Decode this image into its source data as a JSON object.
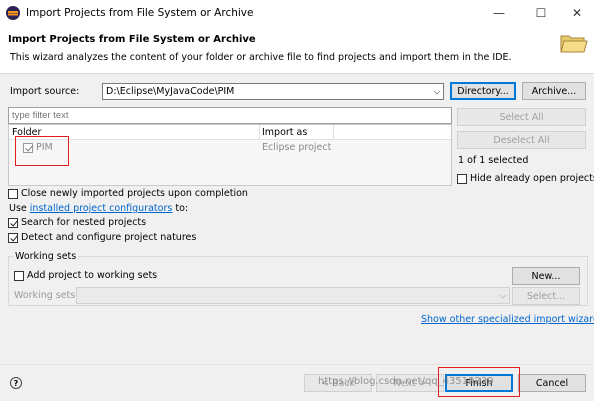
{
  "window": {
    "title": "Import Projects from File System or Archive",
    "minimize": "—",
    "maximize": "☐",
    "close": "✕"
  },
  "header": {
    "title": "Import Projects from File System or Archive",
    "description": "This wizard analyzes the content of your folder or archive file to find projects and import them in the IDE."
  },
  "source": {
    "label": "Import source:",
    "value": "D:\\Eclipse\\MyJavaCode\\PIM",
    "directory_button": "Directory...",
    "archive_button": "Archive..."
  },
  "filter": {
    "placeholder": "type filter text"
  },
  "table": {
    "columns": [
      "Folder",
      "Import as"
    ],
    "rows": [
      {
        "folder": "PIM",
        "import_as": "Eclipse project",
        "checked": true
      }
    ]
  },
  "side": {
    "select_all": "Select All",
    "deselect_all": "Deselect All",
    "selected_count": "1 of 1 selected",
    "hide_open": "Hide already open projects"
  },
  "options": {
    "close_projects": "Close newly imported projects upon completion",
    "use_prefix": "Use ",
    "configurators_link": "installed project configurators",
    "use_suffix": " to:",
    "search_nested": "Search for nested projects",
    "detect_natures": "Detect and configure project natures"
  },
  "working_sets": {
    "group_label": "Working sets",
    "add_label": "Add project to working sets",
    "new_button": "New...",
    "sets_label": "Working sets:",
    "select_button": "Select..."
  },
  "show_wizards_link": "Show other specialized import wizards",
  "footer": {
    "help": "?",
    "back": "< Back",
    "next": "Next >",
    "finish": "Finish",
    "cancel": "Cancel"
  },
  "watermark": "https://blog.csdn.net/qq_43519239"
}
